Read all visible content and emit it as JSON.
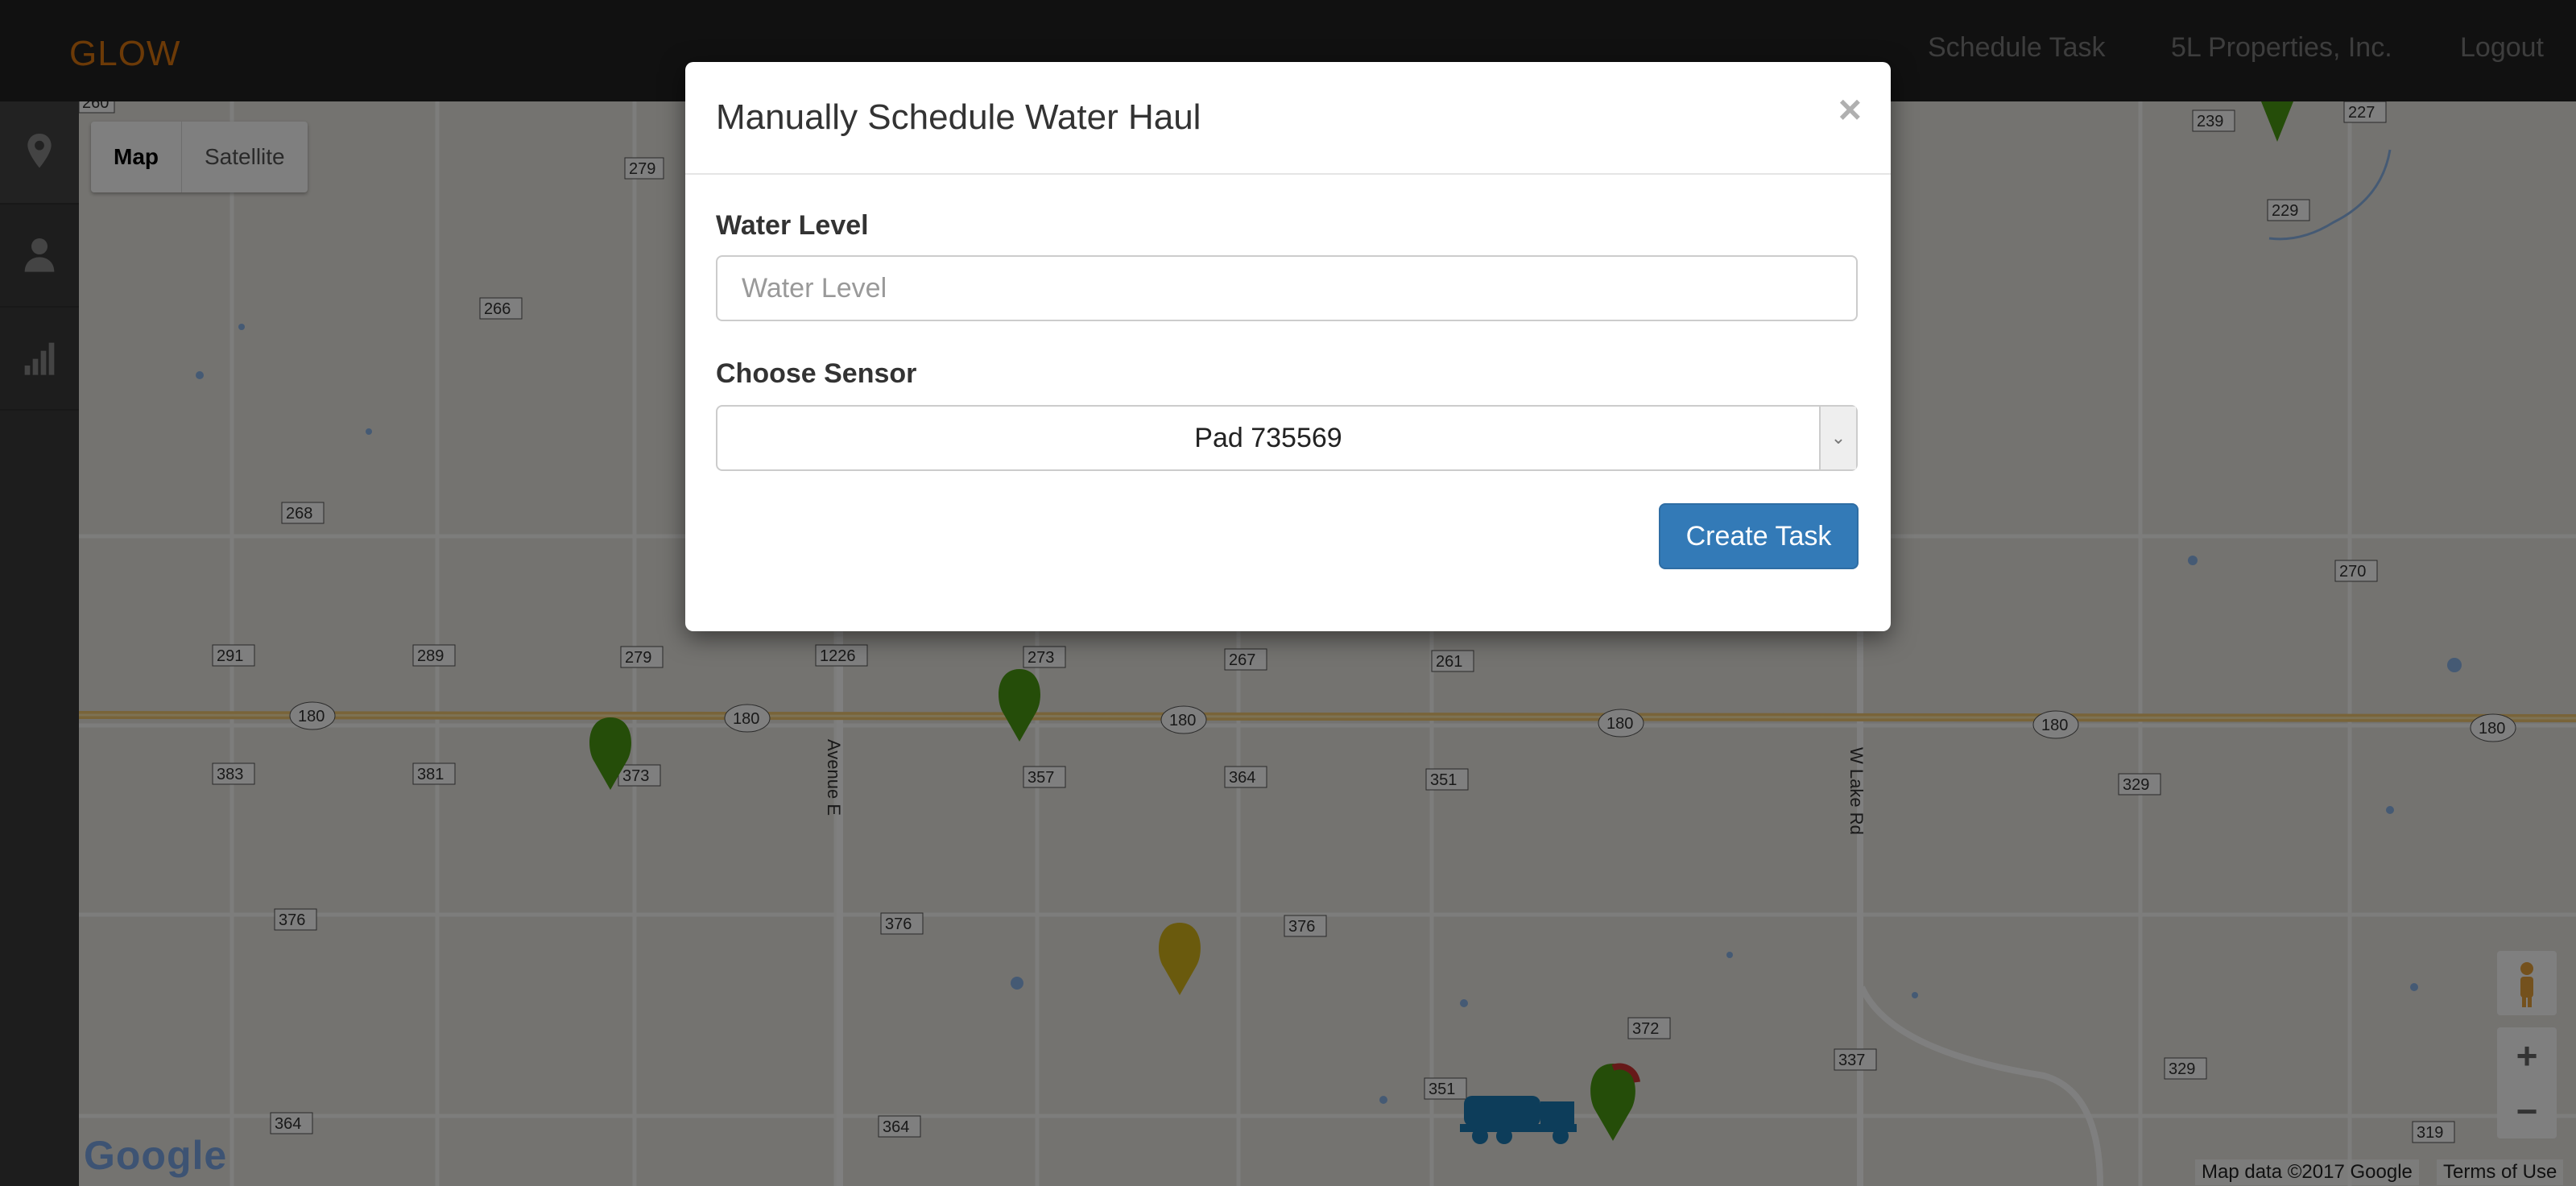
{
  "navbar": {
    "brand": "GLOW",
    "links": [
      "Schedule Task",
      "5L Properties, Inc.",
      "Logout"
    ]
  },
  "sidebar": {
    "items": [
      {
        "icon": "map-marker-icon"
      },
      {
        "icon": "user-icon"
      },
      {
        "icon": "signal-icon"
      }
    ]
  },
  "map": {
    "type_buttons": [
      "Map",
      "Satellite"
    ],
    "active_type": "Map",
    "road_labels": [
      "260",
      "279",
      "266",
      "268",
      "291",
      "289",
      "279",
      "1226",
      "273",
      "267",
      "261",
      "239",
      "227",
      "229",
      "270",
      "383",
      "381",
      "373",
      "357",
      "364",
      "351",
      "329",
      "376",
      "376",
      "376",
      "372",
      "351",
      "337",
      "329",
      "364",
      "364",
      "319",
      "180",
      "Avenue E",
      "W Lake Rd"
    ],
    "attribution": [
      "Map data ©2017 Google",
      "Terms of Use"
    ],
    "logo": "Google",
    "zoom": [
      "+",
      "−"
    ],
    "colors": {
      "pin_green": "#4b9b12",
      "pin_yellow": "#d4b51b",
      "truck": "#1b7ab4",
      "background": "#e8e6e0"
    }
  },
  "modal": {
    "title": "Manually Schedule Water Haul",
    "close": "×",
    "water_level_label": "Water Level",
    "water_level_placeholder": "Water Level",
    "water_level_value": "",
    "sensor_label": "Choose Sensor",
    "sensor_selected": "Pad 735569",
    "submit": "Create Task"
  }
}
